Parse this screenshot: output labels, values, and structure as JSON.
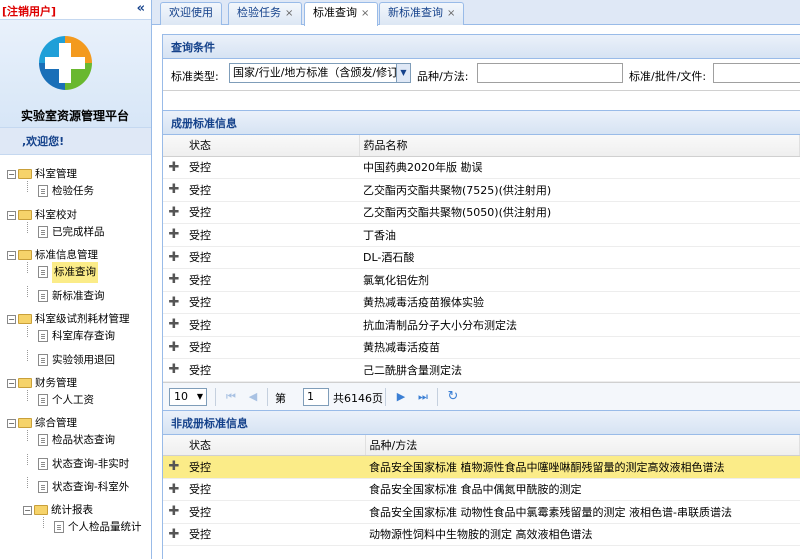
{
  "left": {
    "logout": "[注销用户]",
    "collapse": "«",
    "platform_name": "实验室资源管理平台",
    "welcome": ",欢迎您!"
  },
  "tree": [
    {
      "label": "科室管理",
      "level": 0,
      "kind": "folder"
    },
    {
      "label": "检验任务",
      "level": 1,
      "kind": "doc"
    },
    {
      "label": "科室校对",
      "level": 0,
      "kind": "folder"
    },
    {
      "label": "已完成样品",
      "level": 1,
      "kind": "doc"
    },
    {
      "label": "标准信息管理",
      "level": 0,
      "kind": "folder"
    },
    {
      "label": "标准查询",
      "level": 1,
      "kind": "doc",
      "selected": true
    },
    {
      "label": "新标准查询",
      "level": 1,
      "kind": "doc"
    },
    {
      "label": "科室级试剂耗材管理",
      "level": 0,
      "kind": "folder"
    },
    {
      "label": "科室库存查询",
      "level": 1,
      "kind": "doc"
    },
    {
      "label": "实验领用退回",
      "level": 1,
      "kind": "doc"
    },
    {
      "label": "财务管理",
      "level": 0,
      "kind": "folder"
    },
    {
      "label": "个人工资",
      "level": 1,
      "kind": "doc"
    },
    {
      "label": "综合管理",
      "level": 0,
      "kind": "folder"
    },
    {
      "label": "检品状态查询",
      "level": 1,
      "kind": "doc"
    },
    {
      "label": "状态查询-非实时",
      "level": 1,
      "kind": "doc"
    },
    {
      "label": "状态查询-科室外",
      "level": 1,
      "kind": "doc"
    },
    {
      "label": "统计报表",
      "level": 1,
      "kind": "folder"
    },
    {
      "label": "个人检品量统计",
      "level": 2,
      "kind": "doc"
    }
  ],
  "tabs": [
    {
      "label": "欢迎使用",
      "closable": false
    },
    {
      "label": "检验任务",
      "closable": true
    },
    {
      "label": "标准查询",
      "closable": true,
      "active": true
    },
    {
      "label": "新标准查询",
      "closable": true
    }
  ],
  "query": {
    "title": "查询条件",
    "type_label": "标准类型:",
    "type_value": "国家/行业/地方标准（含颁发/修订",
    "variety_label": "品种/方法:",
    "variety_value": "",
    "batch_label": "标准/批件/文件:",
    "batch_value": ""
  },
  "registered": {
    "title": "成册标准信息",
    "col_status": "状态",
    "col_name": "药品名称",
    "rows": [
      {
        "status": "受控",
        "name": "中国药典2020年版 勘误"
      },
      {
        "status": "受控",
        "name": "乙交酯丙交酯共聚物(7525)(供注射用)"
      },
      {
        "status": "受控",
        "name": "乙交酯丙交酯共聚物(5050)(供注射用)"
      },
      {
        "status": "受控",
        "name": "丁香油"
      },
      {
        "status": "受控",
        "name": "DL-酒石酸"
      },
      {
        "status": "受控",
        "name": "氯氧化铝佐剂"
      },
      {
        "status": "受控",
        "name": "黄热减毒活疫苗猴体实验"
      },
      {
        "status": "受控",
        "name": "抗血清制品分子大小分布测定法"
      },
      {
        "status": "受控",
        "name": "黄热减毒活疫苗"
      },
      {
        "status": "受控",
        "name": "己二酰肼含量测定法"
      }
    ]
  },
  "pager": {
    "page_size": "10",
    "page_prefix": "第",
    "page_num": "1",
    "page_total": "共6146页"
  },
  "unregistered": {
    "title": "非成册标准信息",
    "col_status": "状态",
    "col_name": "品种/方法",
    "rows": [
      {
        "status": "受控",
        "name": "食品安全国家标准 植物源性食品中噻唑啉酮残留量的测定高效液相色谱法",
        "highlight": true
      },
      {
        "status": "受控",
        "name": "食品安全国家标准 食品中偶氮甲酰胺的测定"
      },
      {
        "status": "受控",
        "name": "食品安全国家标准 动物性食品中氯霉素残留量的测定 液相色谱-串联质谱法"
      },
      {
        "status": "受控",
        "name": "动物源性饲料中生物胺的测定 高效液相色谱法"
      }
    ]
  }
}
